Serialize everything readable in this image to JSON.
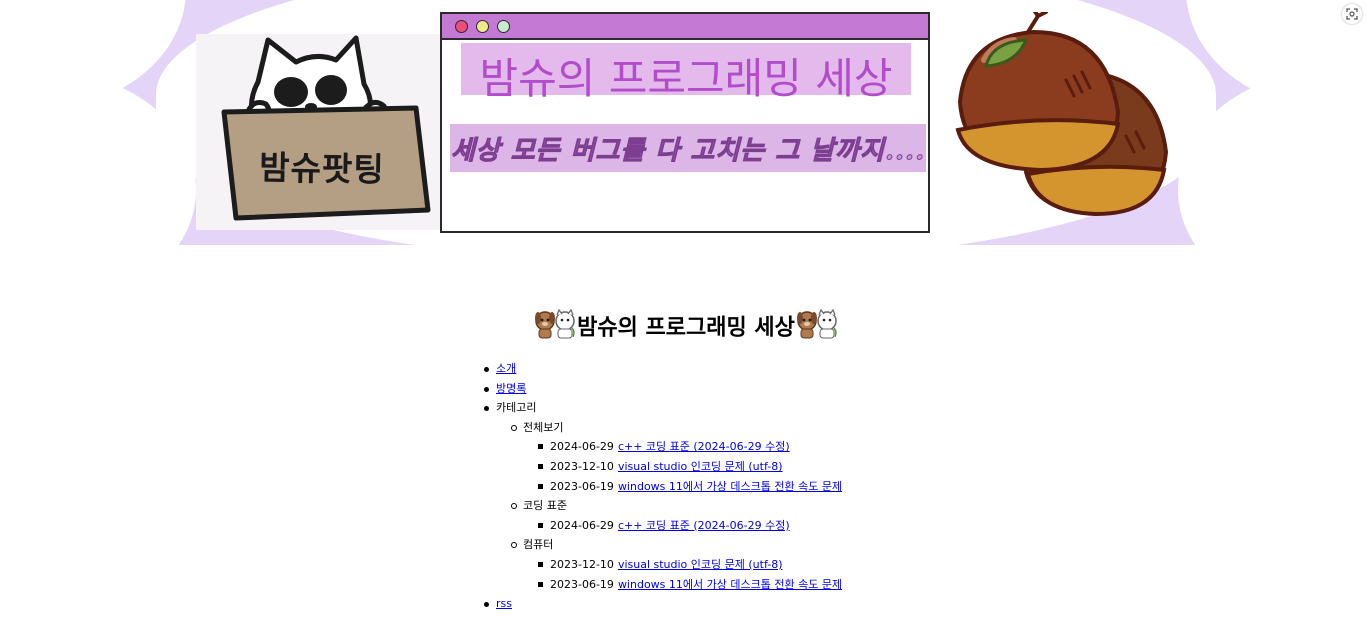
{
  "banner": {
    "sign_text": "밤슈팟팅",
    "title": "밤슈의 프로그래밍 세상",
    "subtitle": "세상 모든 버그를 다 고치는 그 날까지...."
  },
  "page_title": "밤슈의 프로그래밍 세상",
  "nav": {
    "intro": "소개",
    "guestbook": "방명록",
    "category_label": "카테고리",
    "rss": "rss",
    "categories": [
      {
        "label": "전체보기",
        "posts": [
          {
            "date": "2024-06-29",
            "title": "c++ 코딩 표준 (2024-06-29 수정)"
          },
          {
            "date": "2023-12-10",
            "title": "visual studio 인코딩 문제 (utf-8)"
          },
          {
            "date": "2023-06-19",
            "title": "windows 11에서 가상 데스크톱 전환 속도 문제"
          }
        ]
      },
      {
        "label": "코딩 표준",
        "posts": [
          {
            "date": "2024-06-29",
            "title": "c++ 코딩 표준 (2024-06-29 수정)"
          }
        ]
      },
      {
        "label": "컴퓨터",
        "posts": [
          {
            "date": "2023-12-10",
            "title": "visual studio 인코딩 문제 (utf-8)"
          },
          {
            "date": "2023-06-19",
            "title": "windows 11에서 가상 데스크톱 전환 속도 문제"
          }
        ]
      }
    ]
  },
  "icons": {
    "screenshot": "screenshot-capture-icon",
    "title_emoji": "dog-and-cat-emoji"
  },
  "colors": {
    "banner_bg": "#e3d4f8",
    "window_titlebar": "#c479d5",
    "banner_title": "#b14dcb",
    "link": "#0000ee"
  }
}
